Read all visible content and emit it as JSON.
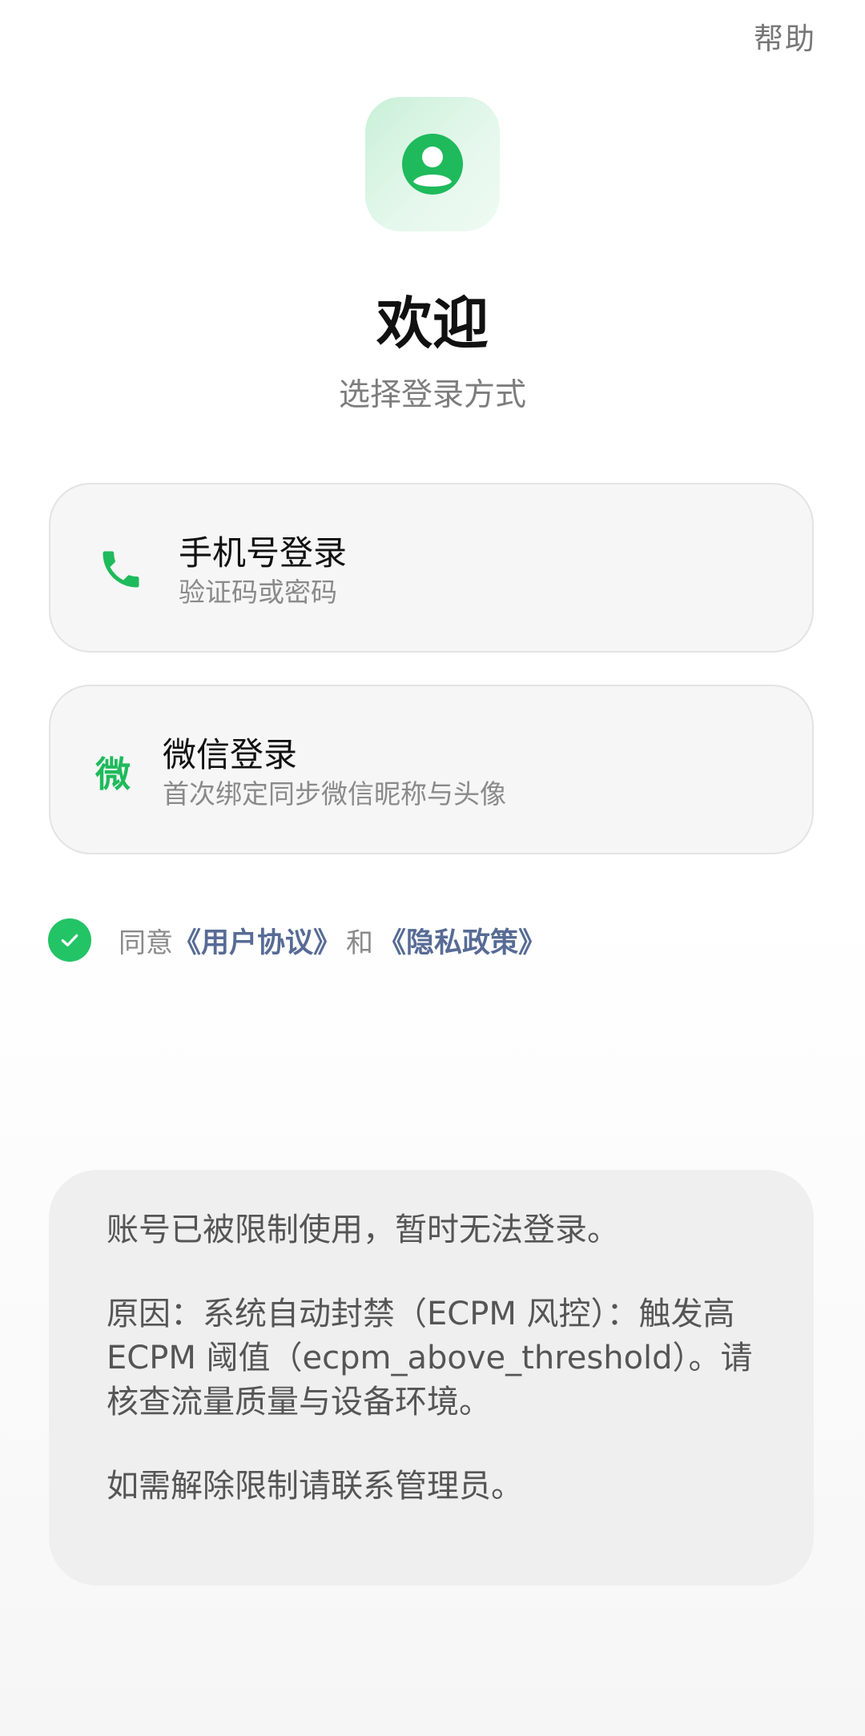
{
  "header": {
    "help_label": "帮助"
  },
  "app_icon": {
    "name": "user-avatar-icon",
    "color": "#1fba5c"
  },
  "welcome": {
    "title": "欢迎",
    "subtitle": "选择登录方式"
  },
  "login_options": [
    {
      "icon": "phone-icon",
      "title": "手机号登录",
      "description": "验证码或密码"
    },
    {
      "icon": "wechat-icon",
      "icon_glyph": "微",
      "title": "微信登录",
      "description": "首次绑定同步微信昵称与头像"
    }
  ],
  "agreement": {
    "checked": true,
    "prefix": "同意",
    "user_agreement": "《用户协议》",
    "conjunction": "和",
    "privacy_policy": "《隐私政策》"
  },
  "notice": {
    "line1": "账号已被限制使用，暂时无法登录。",
    "line2": "原因：系统自动封禁（ECPM 风控）：触发高 ECPM 阈值（ecpm_above_threshold）。请核查流量质量与设备环境。",
    "line3": "如需解除限制请联系管理员。"
  },
  "colors": {
    "brand_green": "#22c466",
    "link_blue": "#576b95",
    "icon_bg": "#d6f4e1"
  }
}
